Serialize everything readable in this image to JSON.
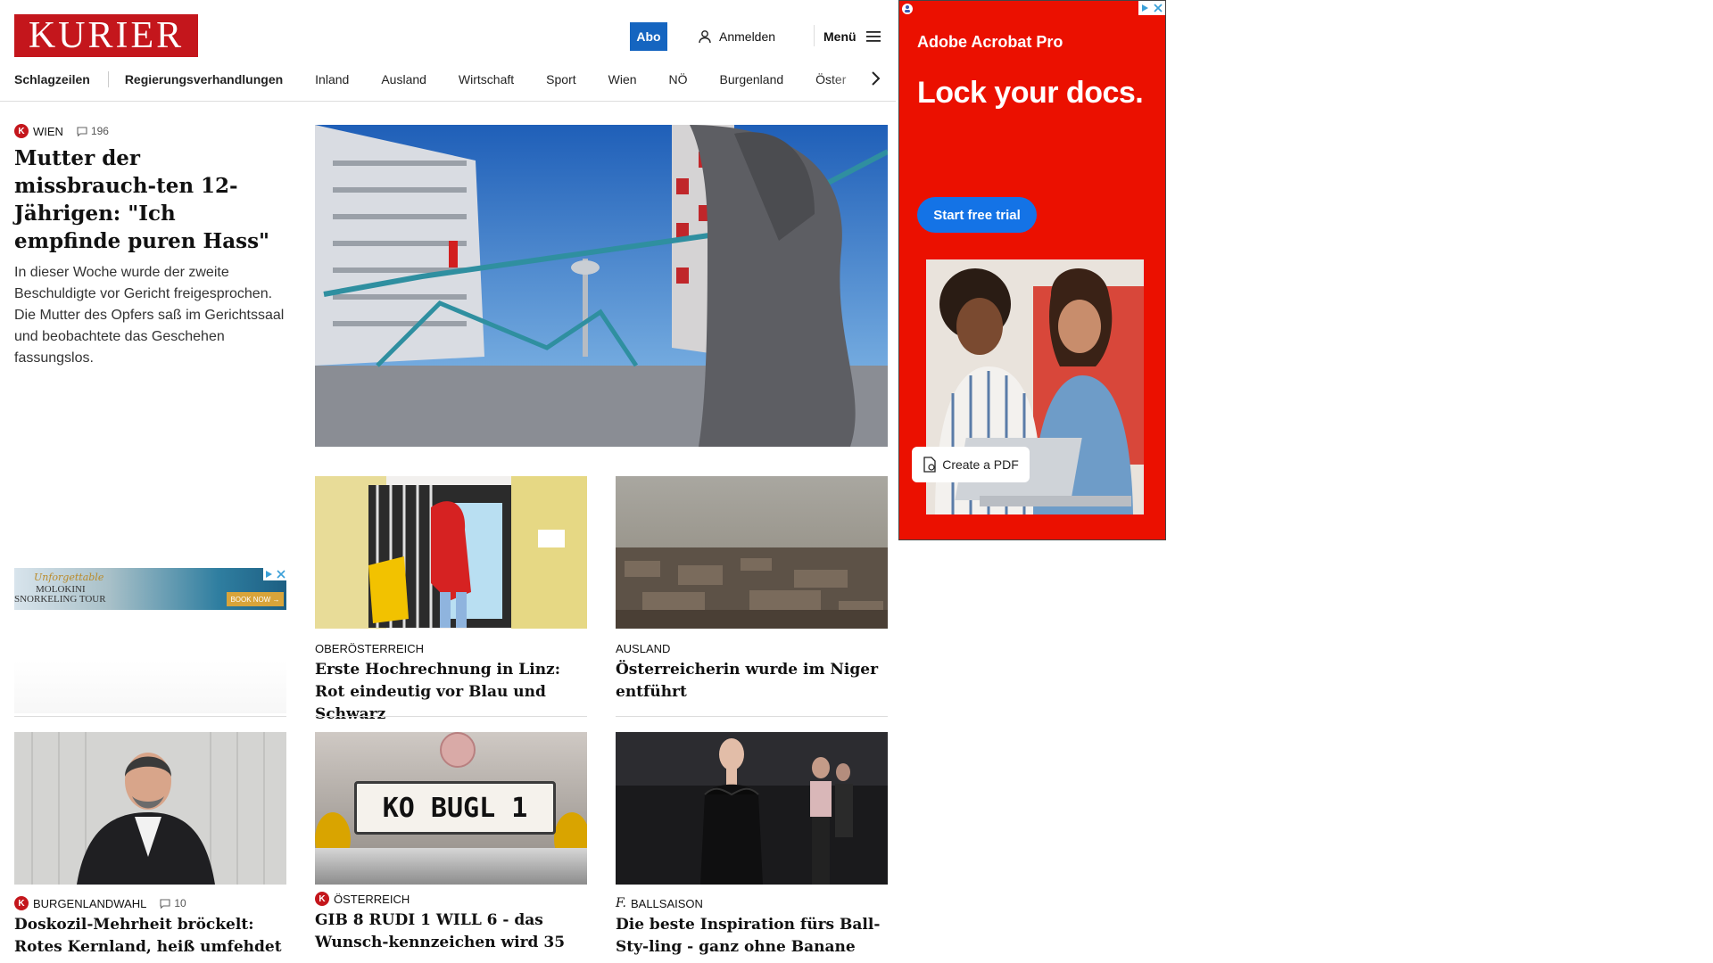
{
  "header": {
    "logo": "KURIER",
    "abo": "Abo",
    "login": "Anmelden",
    "menu": "Menü"
  },
  "nav": {
    "items": [
      "Schlagzeilen",
      "Regierungsverhandlungen",
      "Inland",
      "Ausland",
      "Wirtschaft",
      "Sport",
      "Wien",
      "NÖ",
      "Burgenland",
      "Öster"
    ]
  },
  "lead": {
    "kicker": "WIEN",
    "comments": "196",
    "headline": "Mutter der missbrauch-ten 12-Jährigen: \"Ich empfinde puren Hass\"",
    "teaser": "In dieser Woche wurde der zweite Beschuldigte vor Gericht freigesprochen. Die Mutter des Opfers saß im Gerichtssaal und beobachtete das Geschehen fassungslos."
  },
  "small_ad": {
    "line1": "Unforgettable",
    "line2": "MOLOKINI",
    "line3": "SNORKELING TOUR",
    "cta": "BOOK NOW →"
  },
  "mid_articles": [
    {
      "kicker": "OBERÖSTERREICH",
      "headline": "Erste Hochrechnung in Linz: Rot eindeutig vor Blau und Schwarz"
    },
    {
      "kicker": "AUSLAND",
      "headline": "Österreicherin wurde im Niger entführt"
    }
  ],
  "bottom_articles": [
    {
      "kicker": "BURGENLANDWAHL",
      "comments": "10",
      "headline": "Doskozil-Mehrheit bröckelt: Rotes Kernland, heiß umfehdet"
    },
    {
      "kicker": "ÖSTERREICH",
      "headline": "GIB 8 RUDI 1 WILL 6 - das Wunsch-kennzeichen wird 35",
      "plate": "KO BUGL 1"
    },
    {
      "kicker": "BALLSAISON",
      "headline": "Die beste Inspiration fürs Ball-Sty-ling - ganz ohne Banane"
    }
  ],
  "ad": {
    "brand": "Adobe Acrobat Pro",
    "title": "Lock your docs.",
    "cta": "Start free trial",
    "pdf_button": "Create a PDF"
  },
  "colors": {
    "brand_red": "#c4161c",
    "abo_blue": "#1565c0",
    "ad_red": "#eb1000",
    "ad_blue": "#1473e6"
  }
}
